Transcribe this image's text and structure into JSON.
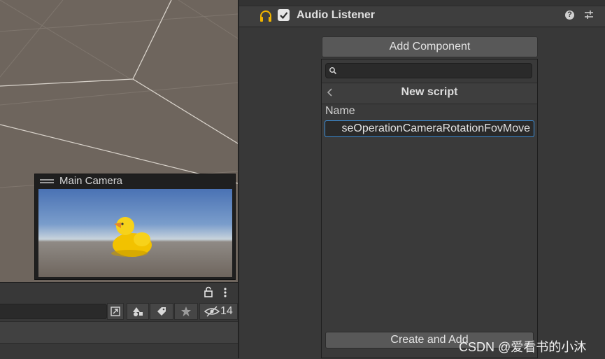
{
  "scene": {
    "camera_preview": {
      "title": "Main Camera"
    }
  },
  "hierarchy_toolbar": {
    "hidden_count": "14",
    "icons": [
      "lock-icon",
      "more-icon",
      "scene-search-icon",
      "shapes-icon",
      "tag-icon",
      "star-icon",
      "eye-slash-icon"
    ]
  },
  "inspector": {
    "component": {
      "title": "Audio Listener",
      "enabled": true,
      "help_icon": "?",
      "accent": "#f0b400"
    },
    "add_component": {
      "label": "Add Component",
      "search_value": "",
      "nav_title": "New script",
      "name_label": "Name",
      "name_value": "seOperationCameraRotationFovMove",
      "create_button": "Create and Add"
    }
  },
  "watermark": "CSDN @爱看书的小沐"
}
